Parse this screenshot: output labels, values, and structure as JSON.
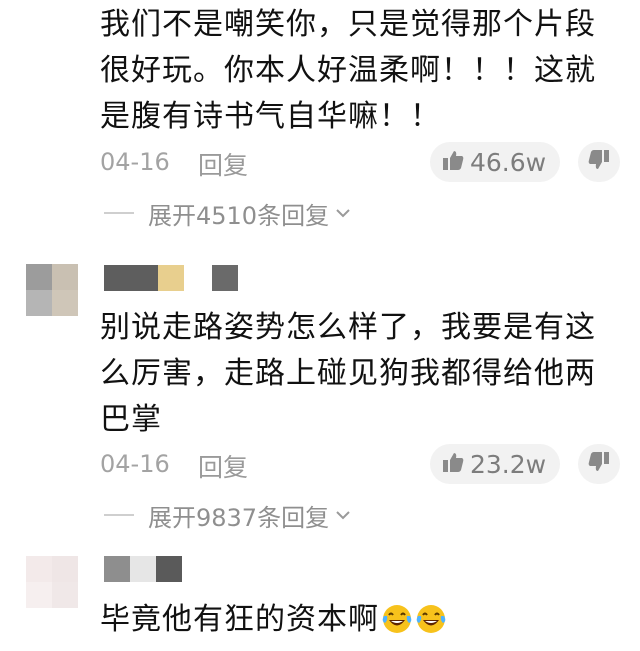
{
  "comments": [
    {
      "text": "我们不是嘲笑你，只是觉得那个片段很好玩。你本人好温柔啊！！！这就是腹有诗书气自华嘛！！",
      "date": "04-16",
      "reply_label": "回复",
      "likes": "46.6w",
      "expand_label": "展开4510条回复"
    },
    {
      "text": "别说走路姿势怎么样了，我要是有这么厉害，走路上碰见狗我都得给他两巴掌",
      "date": "04-16",
      "reply_label": "回复",
      "likes": "23.2w",
      "expand_label": "展开9837条回复"
    },
    {
      "text": "毕竟他有狂的资本啊"
    }
  ],
  "icons": {
    "like": "thumbs-up-icon",
    "dislike": "thumbs-down-icon",
    "expand": "chevron-down-icon",
    "emoji": "laughing-tears-emoji-icon"
  },
  "colors": {
    "meta_text": "#a3a3a3",
    "pill_bg": "#f2f2f2",
    "emoji_face": "#f7c21c"
  }
}
